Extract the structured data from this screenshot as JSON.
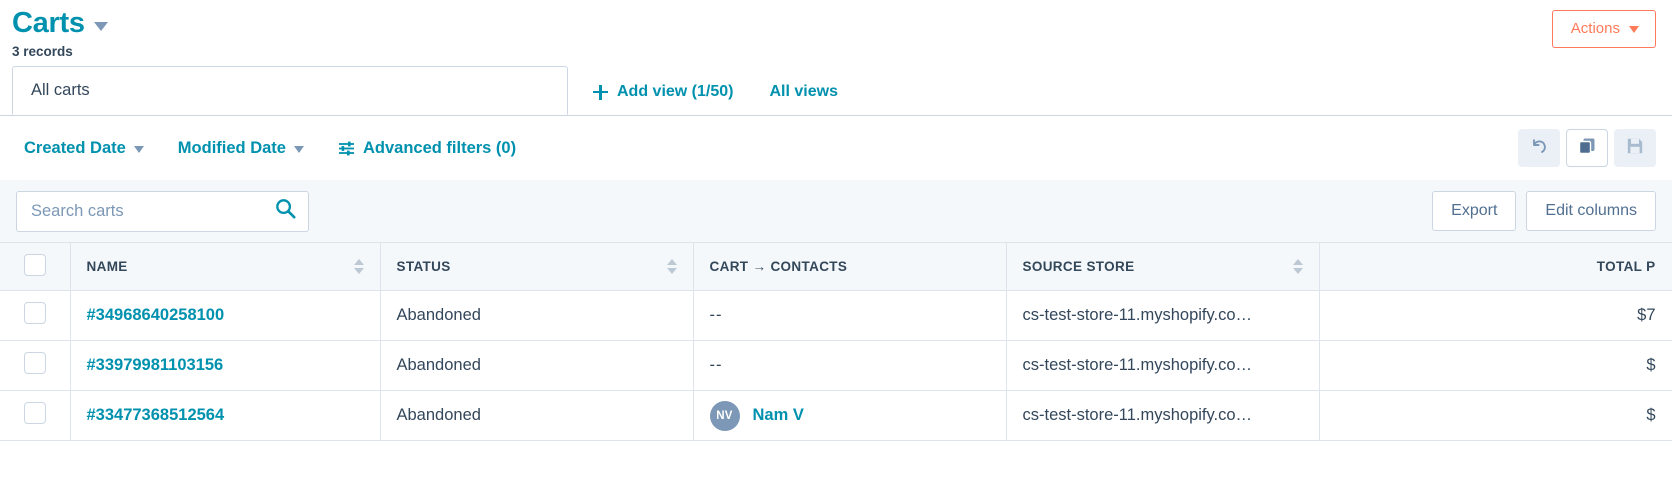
{
  "header": {
    "title": "Carts",
    "record_count": "3 records",
    "actions_label": "Actions"
  },
  "tabs": {
    "active_tab": "All carts",
    "add_view_label": "Add view (1/50)",
    "all_views_label": "All views"
  },
  "filters": {
    "created_date": "Created Date",
    "modified_date": "Modified Date",
    "advanced_filters": "Advanced filters (0)",
    "icon_buttons": [
      {
        "name": "undo-icon",
        "active": false
      },
      {
        "name": "clone-icon",
        "active": true
      },
      {
        "name": "save-icon",
        "active": false
      }
    ]
  },
  "search": {
    "placeholder": "Search carts",
    "value": "",
    "export_label": "Export",
    "edit_columns_label": "Edit columns"
  },
  "table": {
    "columns": [
      {
        "label": "NAME",
        "sortable": true,
        "align": "left"
      },
      {
        "label": "STATUS",
        "sortable": true,
        "align": "left"
      },
      {
        "label": "CART → CONTACTS",
        "sortable": false,
        "align": "left"
      },
      {
        "label": "SOURCE STORE",
        "sortable": true,
        "align": "left"
      },
      {
        "label": "TOTAL P",
        "sortable": false,
        "align": "right"
      }
    ],
    "rows": [
      {
        "name": "#34968640258100",
        "status": "Abandoned",
        "contact": "--",
        "contact_initials": "",
        "source_store": "cs-test-store-11.myshopify.co…",
        "total_price": "$7"
      },
      {
        "name": "#33979981103156",
        "status": "Abandoned",
        "contact": "--",
        "contact_initials": "",
        "source_store": "cs-test-store-11.myshopify.co…",
        "total_price": "$"
      },
      {
        "name": "#33477368512564",
        "status": "Abandoned",
        "contact": "Nam V",
        "contact_initials": "NV",
        "source_store": "cs-test-store-11.myshopify.co…",
        "total_price": "$"
      }
    ]
  },
  "colors": {
    "brand_teal": "#0091ae",
    "accent_orange": "#ff7a59",
    "text_dark": "#33475b",
    "border": "#cbd6e2",
    "header_bg": "#f5f8fa"
  }
}
